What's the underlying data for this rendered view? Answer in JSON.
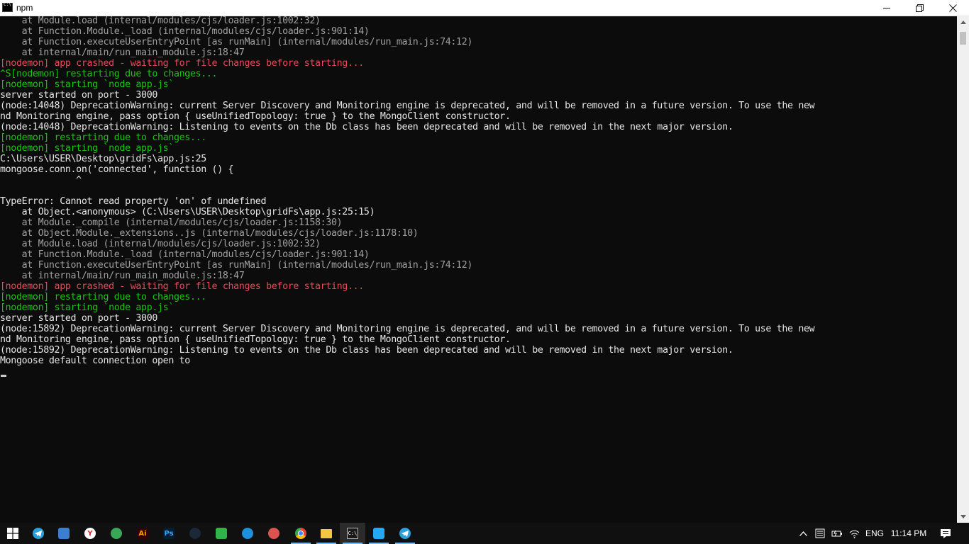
{
  "window": {
    "title": "npm",
    "controls": {
      "minimize": "minimize-icon",
      "maximize": "restore-icon",
      "close": "close-icon"
    }
  },
  "console": {
    "lines": [
      {
        "text": "    at Module.load (internal/modules/cjs/loader.js:1002:32)",
        "color": "gray"
      },
      {
        "text": "    at Function.Module._load (internal/modules/cjs/loader.js:901:14)",
        "color": "gray"
      },
      {
        "text": "    at Function.executeUserEntryPoint [as runMain] (internal/modules/run_main.js:74:12)",
        "color": "gray"
      },
      {
        "text": "    at internal/main/run_main_module.js:18:47",
        "color": "gray"
      },
      {
        "text": "[nodemon] app crashed - waiting for file changes before starting...",
        "color": "red"
      },
      {
        "text": "^S[nodemon] restarting due to changes...",
        "color": "green"
      },
      {
        "text": "[nodemon] starting `node app.js`",
        "color": "green"
      },
      {
        "text": "server started on port - 3000",
        "color": "white"
      },
      {
        "text": "(node:14048) DeprecationWarning: current Server Discovery and Monitoring engine is deprecated, and will be removed in a future version. To use the new",
        "color": "white"
      },
      {
        "text": "nd Monitoring engine, pass option { useUnifiedTopology: true } to the MongoClient constructor.",
        "color": "white"
      },
      {
        "text": "(node:14048) DeprecationWarning: Listening to events on the Db class has been deprecated and will be removed in the next major version.",
        "color": "white"
      },
      {
        "text": "[nodemon] restarting due to changes...",
        "color": "green"
      },
      {
        "text": "[nodemon] starting `node app.js`",
        "color": "green"
      },
      {
        "text": "C:\\Users\\USER\\Desktop\\gridFs\\app.js:25",
        "color": "white"
      },
      {
        "text": "mongoose.conn.on('connected', function () {",
        "color": "white"
      },
      {
        "text": "              ^",
        "color": "white"
      },
      {
        "text": "",
        "color": "white"
      },
      {
        "text": "TypeError: Cannot read property 'on' of undefined",
        "color": "white"
      },
      {
        "text": "    at Object.<anonymous> (C:\\Users\\USER\\Desktop\\gridFs\\app.js:25:15)",
        "color": "white"
      },
      {
        "text": "    at Module._compile (internal/modules/cjs/loader.js:1158:30)",
        "color": "gray"
      },
      {
        "text": "    at Object.Module._extensions..js (internal/modules/cjs/loader.js:1178:10)",
        "color": "gray"
      },
      {
        "text": "    at Module.load (internal/modules/cjs/loader.js:1002:32)",
        "color": "gray"
      },
      {
        "text": "    at Function.Module._load (internal/modules/cjs/loader.js:901:14)",
        "color": "gray"
      },
      {
        "text": "    at Function.executeUserEntryPoint [as runMain] (internal/modules/run_main.js:74:12)",
        "color": "gray"
      },
      {
        "text": "    at internal/main/run_main_module.js:18:47",
        "color": "gray"
      },
      {
        "text": "[nodemon] app crashed - waiting for file changes before starting...",
        "color": "red"
      },
      {
        "text": "[nodemon] restarting due to changes...",
        "color": "green"
      },
      {
        "text": "[nodemon] starting `node app.js`",
        "color": "green"
      },
      {
        "text": "server started on port - 3000",
        "color": "white"
      },
      {
        "text": "(node:15892) DeprecationWarning: current Server Discovery and Monitoring engine is deprecated, and will be removed in a future version. To use the new",
        "color": "white"
      },
      {
        "text": "nd Monitoring engine, pass option { useUnifiedTopology: true } to the MongoClient constructor.",
        "color": "white"
      },
      {
        "text": "(node:15892) DeprecationWarning: Listening to events on the Db class has been deprecated and will be removed in the next major version.",
        "color": "white"
      },
      {
        "text": "Mongoose default connection open to",
        "color": "white"
      }
    ]
  },
  "colors": {
    "console_bg": "#0c0c0c",
    "text_white": "#e6e6e6",
    "text_gray": "#a0a0a0",
    "text_red": "#e74856",
    "text_green": "#16c60c",
    "taskbar_bg": "#101010",
    "running_indicator": "#76b9ed"
  },
  "taskbar": {
    "apps": [
      {
        "name": "start-windows-icon",
        "label": "",
        "color": "#ffffff",
        "running": false
      },
      {
        "name": "telegram-icon",
        "label": "",
        "color": "#2aa1da",
        "running": false
      },
      {
        "name": "this-pc-icon",
        "label": "",
        "color": "#3c7fd0",
        "running": false
      },
      {
        "name": "yandex-browser-icon",
        "label": "Y",
        "color": "#e52620",
        "running": false
      },
      {
        "name": "colorful-app-icon",
        "label": "",
        "color": "#3aa757",
        "running": false
      },
      {
        "name": "adobe-illustrator-icon",
        "label": "Ai",
        "color": "#330000",
        "running": false
      },
      {
        "name": "adobe-photoshop-icon",
        "label": "Ps",
        "color": "#001e36",
        "running": false
      },
      {
        "name": "steam-icon",
        "label": "",
        "color": "#1b2838",
        "running": false
      },
      {
        "name": "phone-app-icon",
        "label": "",
        "color": "#2fb34a",
        "running": false
      },
      {
        "name": "microsoft-edge-icon",
        "label": "",
        "color": "#1e90d9",
        "running": false
      },
      {
        "name": "paint-app-icon",
        "label": "",
        "color": "#d9534f",
        "running": false
      },
      {
        "name": "google-chrome-icon",
        "label": "",
        "color": "#fbbc05",
        "running": true
      },
      {
        "name": "file-explorer-icon",
        "label": "",
        "color": "#f4c542",
        "running": true
      },
      {
        "name": "command-prompt-icon",
        "label": "C:\\",
        "color": "#1a1a1a",
        "running": true,
        "active": true
      },
      {
        "name": "vscode-icon",
        "label": "",
        "color": "#23a8f2",
        "running": true
      },
      {
        "name": "telegram-running-icon",
        "label": "",
        "color": "#2aa1da",
        "running": true
      }
    ],
    "tray": {
      "language": "ENG",
      "time": "11:14 PM",
      "icons": [
        "chevron-up-icon",
        "keyboard-icon",
        "battery-icon",
        "wifi-icon",
        "notification-icon"
      ]
    }
  }
}
